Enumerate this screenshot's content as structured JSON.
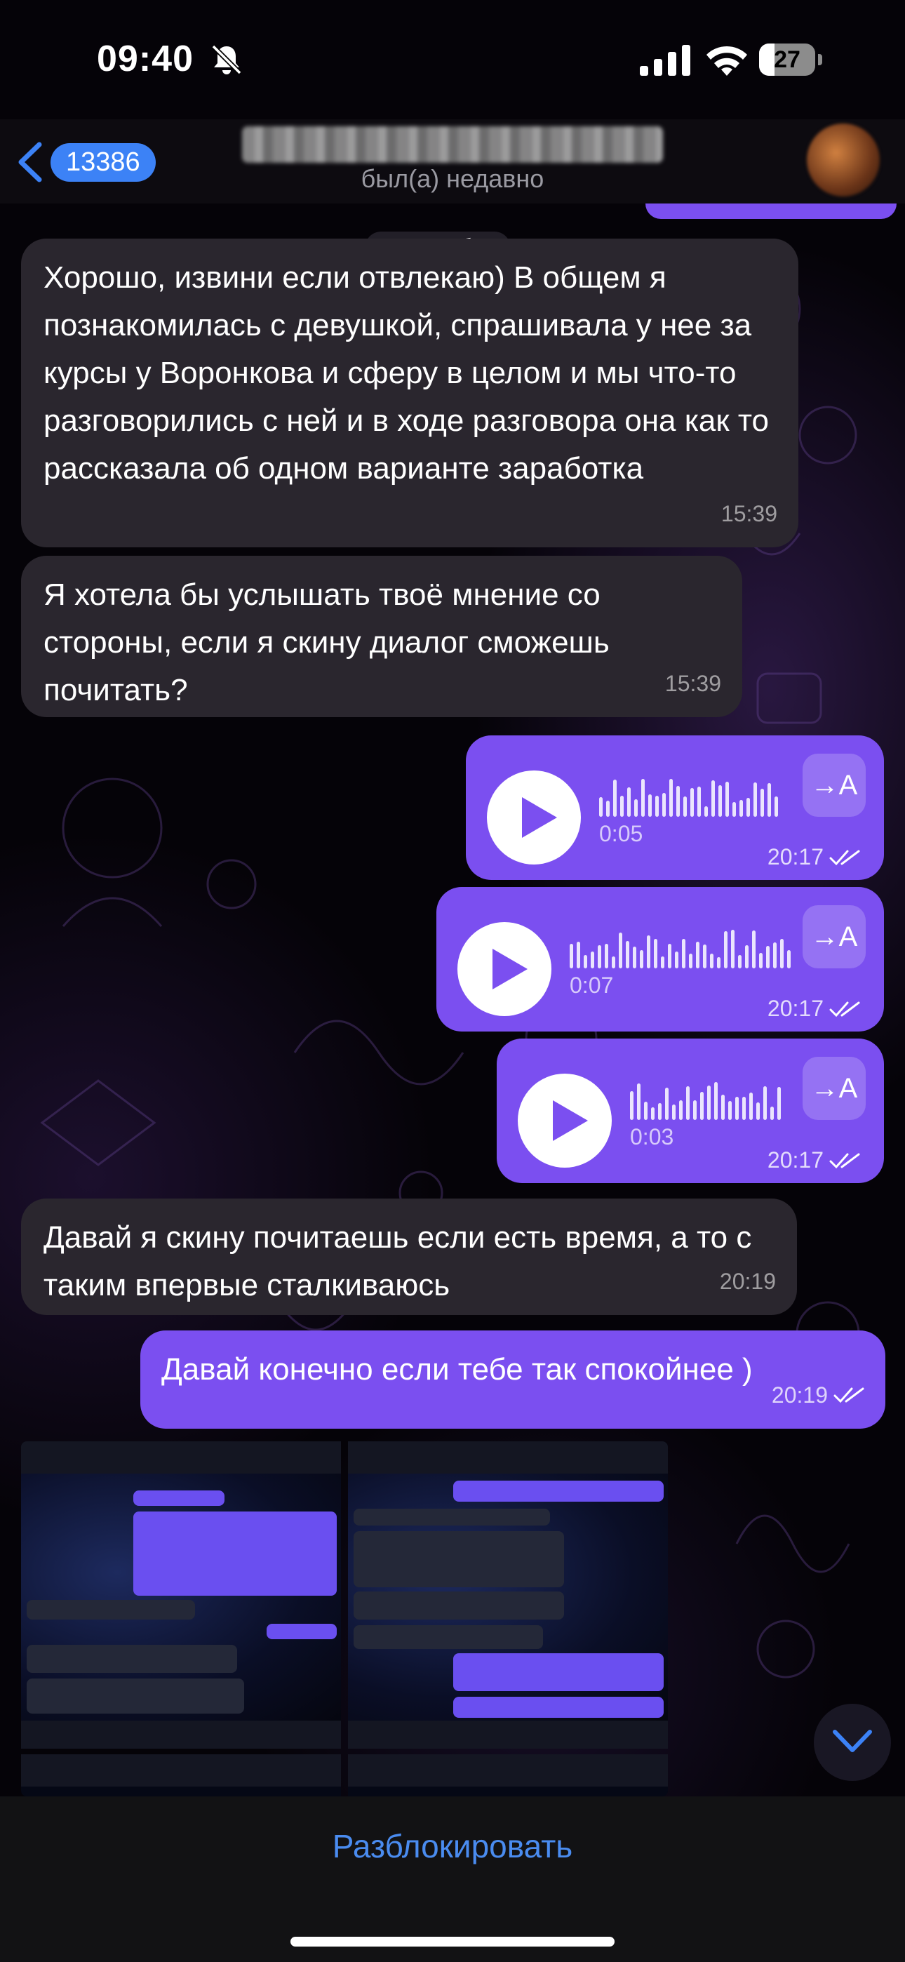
{
  "status_bar": {
    "time": "09:40",
    "battery": "27",
    "battery_level": 0.27
  },
  "header": {
    "back_count": "13386",
    "status": "был(а) недавно"
  },
  "date_separator": "30 октября",
  "messages": [
    {
      "direction": "incoming",
      "text": "Хорошо, извини если отвлекаю) В общем я познакомилась с девушкой, спрашивала у нее за курсы у Воронкова и сферу в целом и мы что-то разговорились с ней и в ходе разговора она как то рассказала об одном варианте заработка",
      "time": "15:39"
    },
    {
      "direction": "incoming",
      "text": "Я хотела бы услышать твоё мнение со стороны, если я скину диалог сможешь почитать?",
      "time": "15:39"
    },
    {
      "direction": "outgoing",
      "type": "voice",
      "duration": "0:05",
      "time": "20:17",
      "transcribe_label": "→A"
    },
    {
      "direction": "outgoing",
      "type": "voice",
      "duration": "0:07",
      "time": "20:17",
      "transcribe_label": "→A"
    },
    {
      "direction": "outgoing",
      "type": "voice",
      "duration": "0:03",
      "time": "20:17",
      "transcribe_label": "→A"
    },
    {
      "direction": "incoming",
      "text": "Давай я скину почитаешь если есть время, а то с таким впервые сталкиваюсь",
      "time": "20:19"
    },
    {
      "direction": "outgoing",
      "text": "Давай конечно если тебе так спокойнее )",
      "time": "20:19"
    }
  ],
  "bottom_bar": {
    "action_label": "Разблокировать"
  },
  "colors": {
    "outgoing_bubble": "#7b4ff0",
    "incoming_bubble": "#2a262e",
    "accent": "#3c82f6",
    "action_text": "#4a8cf0"
  },
  "icons": [
    "bell-slash-icon",
    "signal-icon",
    "wifi-icon",
    "battery-icon",
    "back-chevron-icon",
    "play-icon",
    "double-check-icon",
    "chevron-down-icon"
  ]
}
